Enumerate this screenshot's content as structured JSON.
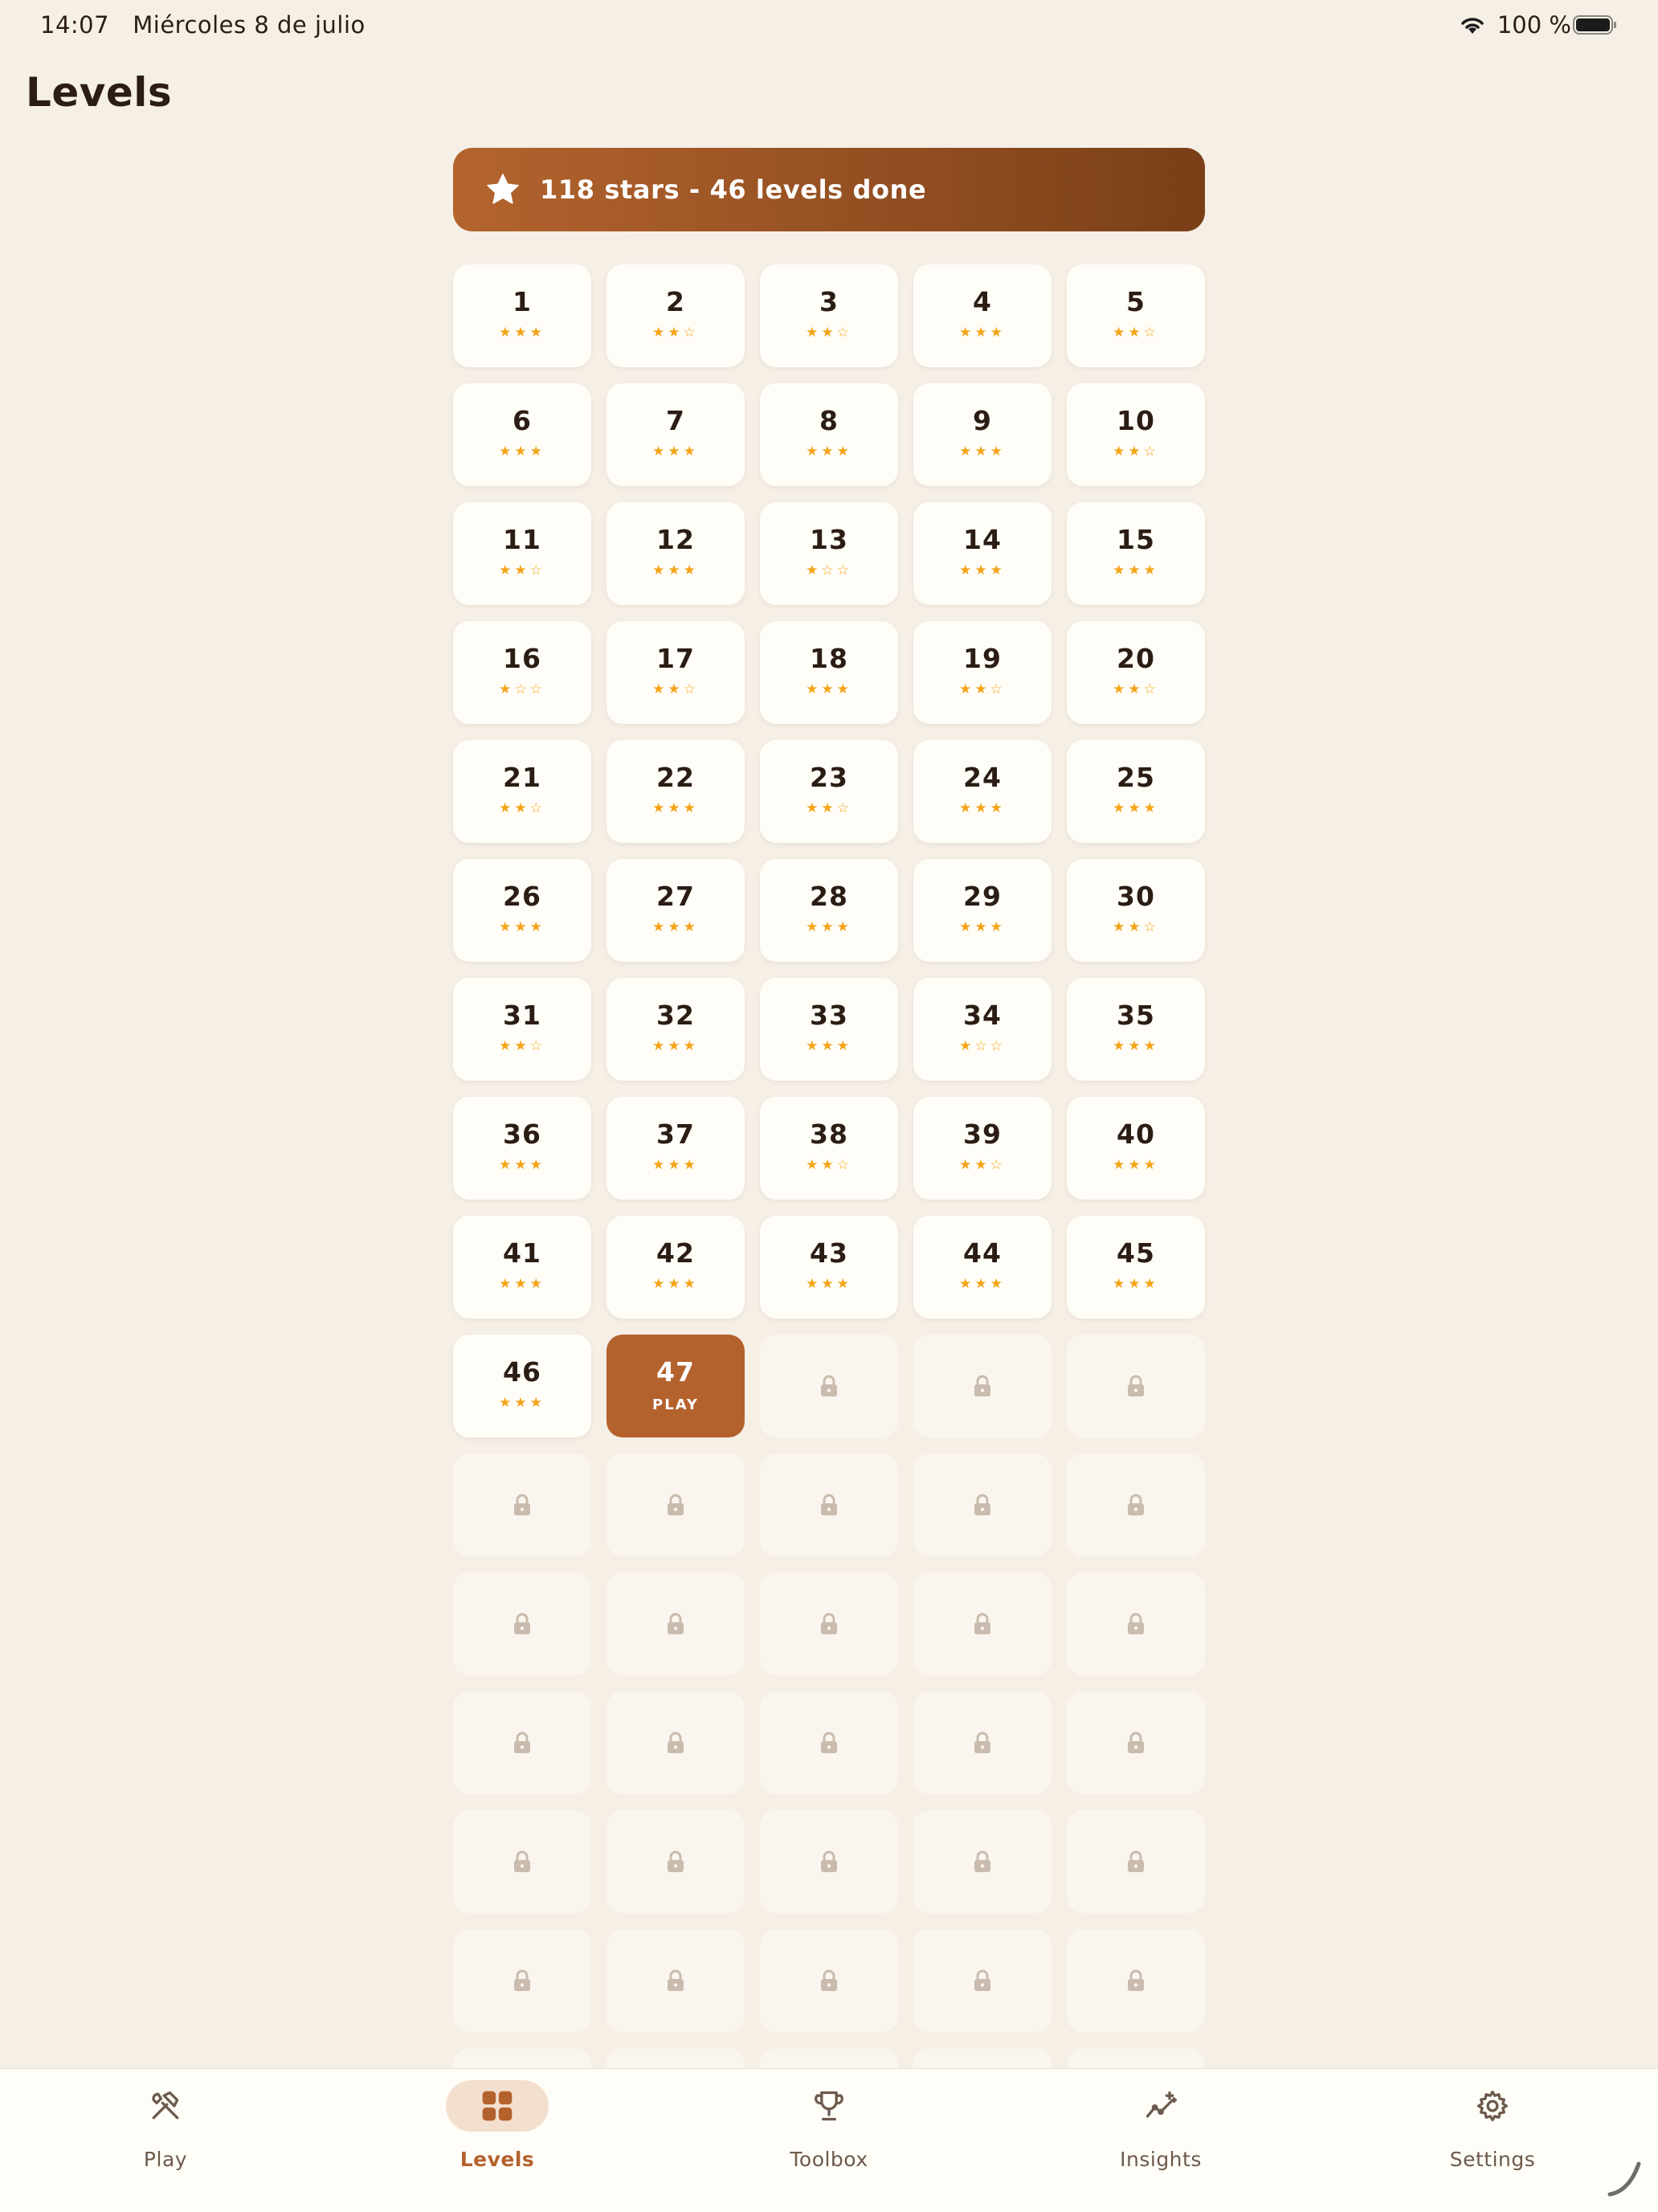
{
  "status_bar": {
    "time": "14:07",
    "date": "Miércoles 8 de julio",
    "battery": "100 %"
  },
  "page": {
    "title": "Levels"
  },
  "banner": {
    "icon": "star-icon",
    "text": "118 stars - 46 levels done"
  },
  "levels": {
    "stars": [
      3,
      2,
      2,
      3,
      2,
      3,
      3,
      3,
      3,
      2,
      2,
      3,
      1,
      3,
      3,
      1,
      2,
      3,
      2,
      2,
      2,
      3,
      2,
      3,
      3,
      3,
      3,
      3,
      3,
      2,
      2,
      3,
      3,
      1,
      3,
      3,
      3,
      2,
      2,
      3,
      3,
      3,
      3,
      3,
      3,
      3
    ],
    "current": {
      "number": "47",
      "label": "PLAY"
    },
    "locked_icon": "lock-icon",
    "filled_star": "★",
    "empty_star": "☆"
  },
  "tabs": [
    {
      "label": "Play",
      "icon": "hammer-wrench-icon",
      "active": false
    },
    {
      "label": "Levels",
      "icon": "grid-icon",
      "active": true
    },
    {
      "label": "Toolbox",
      "icon": "trophy-icon",
      "active": false
    },
    {
      "label": "Insights",
      "icon": "sparkle-chart-icon",
      "active": false
    },
    {
      "label": "Settings",
      "icon": "gear-icon",
      "active": false
    }
  ],
  "colors": {
    "accent": "#b4622d",
    "background": "#f5efe6",
    "star": "#f4a418",
    "tile": "#fffdf7",
    "locked_tile": "#fbf5ef"
  }
}
